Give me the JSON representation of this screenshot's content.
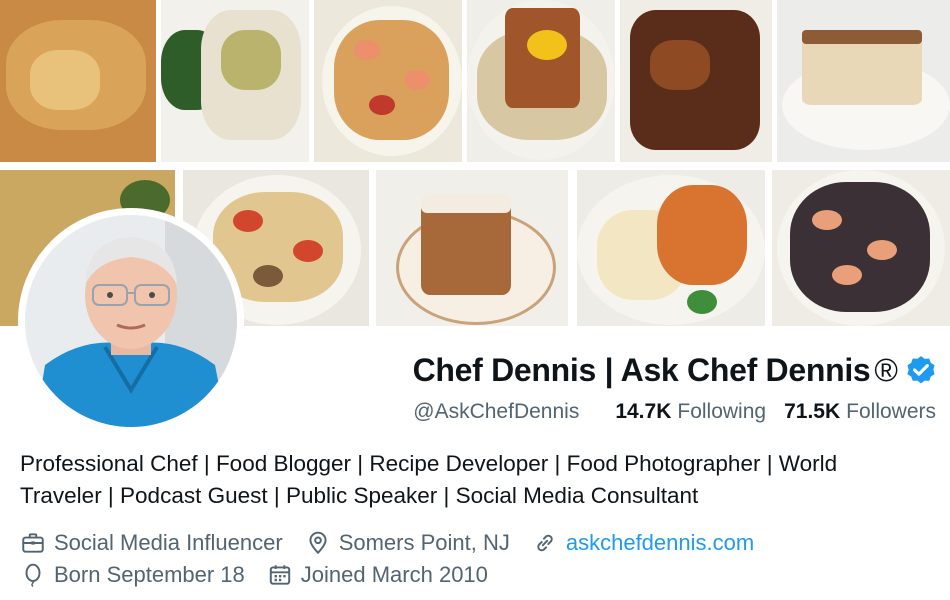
{
  "profile": {
    "display_name": "Chef Dennis | Ask Chef Dennis",
    "registered_mark": "®",
    "handle": "@AskChefDennis",
    "following_count": "14.7K",
    "following_label": "Following",
    "followers_count": "71.5K",
    "followers_label": "Followers",
    "bio": "Professional Chef | Food Blogger | Recipe Developer | Food Photographer | World Traveler | Podcast Guest | Public Speaker | Social Media Consultant",
    "category": "Social Media Influencer",
    "location": "Somers Point, NJ",
    "website": "askchefdennis.com",
    "birthday": "Born September 18",
    "joined": "Joined March 2010"
  },
  "icons": {
    "verified": "verified-badge-icon",
    "category": "briefcase-icon",
    "location": "map-pin-icon",
    "website": "link-icon",
    "birthday": "balloon-icon",
    "joined": "calendar-icon"
  },
  "colors": {
    "accent": "#1d9bf0",
    "muted_text": "#536471",
    "text": "#0f1419"
  }
}
